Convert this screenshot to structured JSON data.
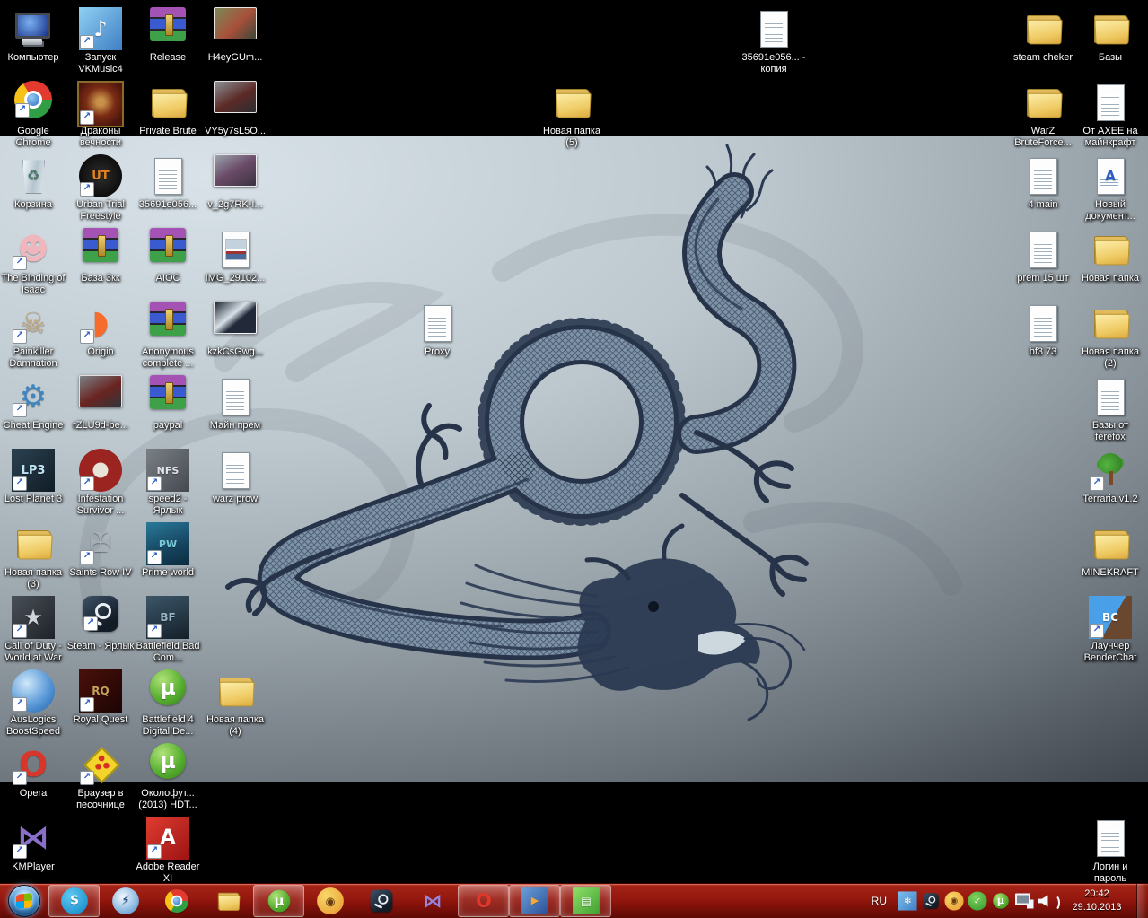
{
  "colors": {
    "taskbar_red": "#94180e",
    "wallpaper_light": "#d8e2e8",
    "wallpaper_dark": "#333940",
    "dragon_ink": "#2b3a52"
  },
  "icons_meta": {
    "shortcut_arrow_glyph": "↗"
  },
  "desktop": {
    "icons": [
      {
        "id": "computer",
        "label": "Компьютер",
        "col": 0,
        "row": 0,
        "art": {
          "kind": "computer"
        }
      },
      {
        "id": "vkmusic4",
        "label": "Запуск VKMusic4",
        "col": 1,
        "row": 0,
        "art": {
          "kind": "app",
          "bg": "linear-gradient(135deg,#8fd0f4,#3f7fc4)",
          "glyph": "♪",
          "fg": "#ffffff",
          "fs": 24,
          "shortcut": true
        }
      },
      {
        "id": "release",
        "label": "Release",
        "col": 2,
        "row": 0,
        "art": {
          "kind": "rar"
        }
      },
      {
        "id": "h4eygum",
        "label": "H4eyGUm...",
        "col": 3,
        "row": 0,
        "art": {
          "kind": "photo",
          "bg": "linear-gradient(135deg,#7a8a5a,#a8503a 55%,#3c4638)"
        }
      },
      {
        "id": "google-chrome",
        "label": "Google Chrome",
        "col": 0,
        "row": 1,
        "art": {
          "kind": "chrome",
          "shortcut": true
        }
      },
      {
        "id": "drakony-vechnosti",
        "label": "Драконы вечности",
        "col": 1,
        "row": 1,
        "art": {
          "kind": "app",
          "bg": "radial-gradient(circle at 50% 45%,#c89048 12%,#7a2c14 45%,#4a150d 80%)",
          "border": "#8a6a2a",
          "shortcut": true
        }
      },
      {
        "id": "private-brute",
        "label": "Private Brute",
        "col": 2,
        "row": 1,
        "art": {
          "kind": "folder"
        }
      },
      {
        "id": "vy5y7sl5o",
        "label": "VY5y7sL5O...",
        "col": 3,
        "row": 1,
        "art": {
          "kind": "photo",
          "bg": "linear-gradient(150deg,#8a9298,#5c2a26 55%,#2a2e33)"
        }
      },
      {
        "id": "recycle-bin",
        "label": "Корзина",
        "col": 0,
        "row": 2,
        "art": {
          "kind": "recycle",
          "glyph": "♻",
          "fg": "#4a7a6a",
          "fs": 16
        }
      },
      {
        "id": "urban-trial",
        "label": "Urban Trial Freestyle",
        "col": 1,
        "row": 2,
        "art": {
          "kind": "app",
          "bg": "radial-gradient(circle,#2e2e2e,#000000)",
          "glyph": "UT",
          "fg": "#e8821e",
          "fs": 13,
          "round": true,
          "bold": true,
          "shortcut": true
        }
      },
      {
        "id": "doc-35691e056",
        "label": "35691e056...",
        "col": 2,
        "row": 2,
        "art": {
          "kind": "doc"
        }
      },
      {
        "id": "v2g7rk",
        "label": "v_2g7RK-I...",
        "col": 3,
        "row": 2,
        "art": {
          "kind": "photo",
          "bg": "linear-gradient(150deg,#9aa4ac,#6a4a68 50%,#3a3340)"
        }
      },
      {
        "id": "binding-of-isaac",
        "label": "The Binding of Isaac",
        "col": 0,
        "row": 3,
        "art": {
          "kind": "app",
          "glyph": "☻",
          "fg": "#f0b6be",
          "fs": 34,
          "shortcut": true
        }
      },
      {
        "id": "baza-3kk",
        "label": "База 3кк",
        "col": 1,
        "row": 3,
        "art": {
          "kind": "rar"
        }
      },
      {
        "id": "aioc",
        "label": "AIOC",
        "col": 2,
        "row": 3,
        "art": {
          "kind": "rar"
        }
      },
      {
        "id": "img-29102",
        "label": "IMG_29102...",
        "col": 3,
        "row": 3,
        "art": {
          "kind": "imgdoc"
        }
      },
      {
        "id": "painkiller-damnation",
        "label": "Painkiller Damnation",
        "col": 0,
        "row": 4,
        "art": {
          "kind": "app",
          "glyph": "☠",
          "fg": "#c8a87a",
          "fs": 32,
          "shortcut": true
        }
      },
      {
        "id": "origin",
        "label": "Origin",
        "col": 1,
        "row": 4,
        "art": {
          "kind": "app",
          "glyph": "◗",
          "fg": "#f56c2d",
          "fs": 36,
          "bold": true,
          "shortcut": true
        }
      },
      {
        "id": "anonymous-complete",
        "label": "Anonymous complete ...",
        "col": 2,
        "row": 4,
        "art": {
          "kind": "rar"
        }
      },
      {
        "id": "kzkcsgwg",
        "label": "kzkCsGwg...",
        "col": 3,
        "row": 4,
        "art": {
          "kind": "photo",
          "bg": "linear-gradient(140deg,#1c2430,#d8e0e8 42%,#222a3a 60%)"
        }
      },
      {
        "id": "cheat-engine",
        "label": "Cheat Engine",
        "col": 0,
        "row": 5,
        "art": {
          "kind": "app",
          "glyph": "⚙",
          "fg": "#3f86c0",
          "fs": 34,
          "shortcut": true
        }
      },
      {
        "id": "rzlu9d",
        "label": "rZLU9d-be...",
        "col": 1,
        "row": 5,
        "art": {
          "kind": "photo",
          "bg": "linear-gradient(150deg,#7a8288,#6a2420 55%,#30353a)"
        }
      },
      {
        "id": "paypal",
        "label": "paypal",
        "col": 2,
        "row": 5,
        "art": {
          "kind": "rar"
        }
      },
      {
        "id": "main-prem",
        "label": "Майн прем",
        "col": 3,
        "row": 5,
        "art": {
          "kind": "doc"
        }
      },
      {
        "id": "lost-planet-3",
        "label": "Lost Planet 3",
        "col": 0,
        "row": 6,
        "art": {
          "kind": "app",
          "bg": "linear-gradient(135deg,#2c4250,#101c26)",
          "glyph": "LP3",
          "fg": "#bfe3f4",
          "fs": 13,
          "bold": true,
          "shortcut": true
        }
      },
      {
        "id": "infestation",
        "label": "Infestation Survivor ...",
        "col": 1,
        "row": 6,
        "art": {
          "kind": "app",
          "bg": "radial-gradient(circle,#e8e4da 24%,#9c2420 26%)",
          "round": true,
          "shortcut": true
        }
      },
      {
        "id": "speed2",
        "label": "speed2 - Ярлык",
        "col": 2,
        "row": 6,
        "art": {
          "kind": "app",
          "bg": "linear-gradient(135deg,#7a8086,#44494f)",
          "glyph": "NFS",
          "fg": "#e0e4e8",
          "fs": 11,
          "bold": true,
          "shortcut": true
        }
      },
      {
        "id": "warz-prow",
        "label": "warz prow",
        "col": 3,
        "row": 6,
        "art": {
          "kind": "doc"
        }
      },
      {
        "id": "new-folder-3",
        "label": "Новая папка (3)",
        "col": 0,
        "row": 7,
        "art": {
          "kind": "folder"
        }
      },
      {
        "id": "saints-row-iv",
        "label": "Saints Row IV",
        "col": 1,
        "row": 7,
        "art": {
          "kind": "app",
          "glyph": "✠",
          "fg": "#a8aeb6",
          "fs": 30,
          "shortcut": true
        }
      },
      {
        "id": "prime-world",
        "label": "Prime world",
        "col": 2,
        "row": 7,
        "art": {
          "kind": "app",
          "bg": "linear-gradient(160deg,#2a7a9a,#15445e 60%,#0c2c40)",
          "glyph": "PW",
          "fg": "#7ac8d8",
          "fs": 11,
          "bold": true,
          "shortcut": true
        }
      },
      {
        "id": "call-of-duty-waw",
        "label": "Call of Duty - World at War",
        "col": 0,
        "row": 8,
        "art": {
          "kind": "app",
          "bg": "linear-gradient(135deg,#4a5058,#1e2228)",
          "glyph": "★",
          "fg": "#d0d4d8",
          "fs": 24,
          "shortcut": true
        }
      },
      {
        "id": "steam-shortcut",
        "label": "Steam - Ярлык",
        "col": 1,
        "row": 8,
        "art": {
          "kind": "steam",
          "shortcut": true
        }
      },
      {
        "id": "battlefield-bc",
        "label": "Battlefield Bad Com...",
        "col": 2,
        "row": 8,
        "art": {
          "kind": "app",
          "bg": "linear-gradient(160deg,#3c5668,#141f28)",
          "glyph": "BF",
          "fg": "#9ab4c4",
          "fs": 12,
          "bold": true,
          "shortcut": true
        }
      },
      {
        "id": "auslogics-boostspeed",
        "label": "AusLogics BoostSpeed",
        "col": 0,
        "row": 9,
        "art": {
          "kind": "app",
          "bg": "radial-gradient(circle at 35% 32%,#cfe8fa,#5a9ad8 55%,#1f5fa8)",
          "round": true,
          "shortcut": true
        }
      },
      {
        "id": "royal-quest",
        "label": "Royal Quest",
        "col": 1,
        "row": 9,
        "art": {
          "kind": "app",
          "bg": "linear-gradient(135deg,#4a100a,#1c0504)",
          "glyph": "RQ",
          "fg": "#c8a05a",
          "fs": 12,
          "bold": true,
          "shortcut": true
        }
      },
      {
        "id": "battlefield-4-torrent",
        "label": "Battlefield 4 Digital De...",
        "col": 2,
        "row": 9,
        "art": {
          "kind": "utorrent",
          "glyph": "µ",
          "fg": "#ffffff",
          "fs": 24,
          "bold": true
        }
      },
      {
        "id": "new-folder-4",
        "label": "Новая папка (4)",
        "col": 3,
        "row": 9,
        "art": {
          "kind": "folder"
        }
      },
      {
        "id": "opera",
        "label": "Opera",
        "col": 0,
        "row": 10,
        "art": {
          "kind": "app",
          "glyph": "O",
          "fg": "#d8362a",
          "fs": 38,
          "bold": true,
          "shortcut": true
        }
      },
      {
        "id": "sandbox-browser",
        "label": "Браузер в песочнице",
        "col": 1,
        "row": 10,
        "art": {
          "kind": "sandbox",
          "shortcut": true
        }
      },
      {
        "id": "okolofutbola-torrent",
        "label": "Околофут... (2013) HDT...",
        "col": 2,
        "row": 10,
        "art": {
          "kind": "utorrent",
          "glyph": "µ",
          "fg": "#ffffff",
          "fs": 24,
          "bold": true
        }
      },
      {
        "id": "kmplayer",
        "label": "KMPlayer",
        "col": 0,
        "row": 11,
        "art": {
          "kind": "app",
          "glyph": "⋈",
          "fg": "#8a6fc8",
          "fs": 36,
          "bold": true,
          "shortcut": true
        }
      },
      {
        "id": "adobe-reader-xi",
        "label": "Adobe Reader XI",
        "col": 2,
        "row": 11,
        "art": {
          "kind": "app",
          "bg": "linear-gradient(135deg,#e03c30,#9c1414)",
          "glyph": "A",
          "fg": "#ffffff",
          "fs": 22,
          "bold": true,
          "shortcut": true
        }
      },
      {
        "id": "proxy",
        "label": "Proxy",
        "col": 6,
        "row": 4,
        "art": {
          "kind": "doc"
        }
      },
      {
        "id": "new-folder-5",
        "label": "Новая папка (5)",
        "col": 8,
        "row": 1,
        "art": {
          "kind": "folder"
        }
      },
      {
        "id": "doc-35691e056-copy",
        "label": "35691e056... - копия",
        "col": 11,
        "row": 0,
        "art": {
          "kind": "doc"
        }
      },
      {
        "id": "steam-cheker",
        "label": "steam cheker",
        "col": 15,
        "row": 0,
        "art": {
          "kind": "folder"
        }
      },
      {
        "id": "bazy",
        "label": "Базы",
        "col": 16,
        "row": 0,
        "art": {
          "kind": "folder"
        }
      },
      {
        "id": "warz-bruteforce",
        "label": "WarZ BruteForce...",
        "col": 15,
        "row": 1,
        "art": {
          "kind": "folder"
        }
      },
      {
        "id": "ot-axee",
        "label": "От AXEE на майнкрафт",
        "col": 16,
        "row": 1,
        "art": {
          "kind": "doc"
        }
      },
      {
        "id": "4-main",
        "label": "4 main",
        "col": 15,
        "row": 2,
        "art": {
          "kind": "doc"
        }
      },
      {
        "id": "new-document",
        "label": "Новый документ...",
        "col": 16,
        "row": 2,
        "art": {
          "kind": "worddoc",
          "glyph": "A",
          "fg": "#2a5fc4",
          "fs": 15,
          "bold": true
        }
      },
      {
        "id": "prem-15",
        "label": "prem 15 шт",
        "col": 15,
        "row": 3,
        "art": {
          "kind": "doc"
        }
      },
      {
        "id": "new-folder",
        "label": "Новая папка",
        "col": 16,
        "row": 3,
        "art": {
          "kind": "folder"
        }
      },
      {
        "id": "bf3-73",
        "label": "bf3 73",
        "col": 15,
        "row": 4,
        "art": {
          "kind": "doc"
        }
      },
      {
        "id": "new-folder-2",
        "label": "Новая папка (2)",
        "col": 16,
        "row": 4,
        "art": {
          "kind": "folder"
        }
      },
      {
        "id": "bazy-ot-ferefox",
        "label": "Базы от ferefox",
        "col": 16,
        "row": 5,
        "art": {
          "kind": "doc"
        }
      },
      {
        "id": "terraria",
        "label": "Terraria v1.2",
        "col": 16,
        "row": 6,
        "art": {
          "kind": "tree",
          "shortcut": true
        }
      },
      {
        "id": "minekraft",
        "label": "MINEKRAFT",
        "col": 16,
        "row": 7,
        "art": {
          "kind": "folder"
        }
      },
      {
        "id": "launcher-benderchat",
        "label": "Лаунчер BenderChat",
        "col": 16,
        "row": 8,
        "art": {
          "kind": "app",
          "bg": "linear-gradient(120deg,#4aa0e8 0 55%,#6a4830 55% 100%)",
          "glyph": "BC",
          "fg": "#ffffff",
          "fs": 12,
          "bold": true,
          "shortcut": true
        }
      },
      {
        "id": "login-i-parol",
        "label": "Логин и пароль",
        "col": 16,
        "row": 11,
        "art": {
          "kind": "doc"
        }
      }
    ]
  },
  "taskbar": {
    "buttons": [
      {
        "id": "skype",
        "active": true,
        "art": {
          "kind": "app",
          "bg": "radial-gradient(circle at 35% 30%,#5ec8f0,#0f86c8)",
          "glyph": "S",
          "fg": "#ffffff",
          "fs": 22,
          "round": true,
          "bold": true
        }
      },
      {
        "id": "daemon-tools",
        "active": false,
        "art": {
          "kind": "app",
          "bg": "radial-gradient(circle at 40% 35%,#f4faff,#8ab8e0 60%,#4a84c0)",
          "glyph": "⚡",
          "fg": "#1c4f8a",
          "fs": 22,
          "round": true
        }
      },
      {
        "id": "chrome",
        "active": false,
        "art": {
          "kind": "chrome"
        }
      },
      {
        "id": "windows-explorer",
        "active": false,
        "art": {
          "kind": "folder"
        }
      },
      {
        "id": "utorrent",
        "active": true,
        "art": {
          "kind": "utorrent",
          "glyph": "µ",
          "fg": "#ffffff",
          "fs": 24,
          "bold": true
        }
      },
      {
        "id": "mediaget",
        "active": false,
        "art": {
          "kind": "app",
          "bg": "radial-gradient(circle at 35% 30%,#f8d868,#e8962e)",
          "glyph": "◉",
          "fg": "#6a3c10",
          "fs": 20,
          "round": true
        }
      },
      {
        "id": "steam",
        "active": false,
        "art": {
          "kind": "steam"
        }
      },
      {
        "id": "kmplayer",
        "active": false,
        "art": {
          "kind": "app",
          "glyph": "⋈",
          "fg": "#9a82d8",
          "fs": 34,
          "bold": true
        }
      },
      {
        "id": "opera",
        "active": true,
        "art": {
          "kind": "app",
          "glyph": "O",
          "fg": "#e0382a",
          "fs": 34,
          "bold": true
        }
      },
      {
        "id": "windows-media-player",
        "active": true,
        "art": {
          "kind": "app",
          "bg": "linear-gradient(135deg,#6a9fd8,#2a4f98)",
          "glyph": "▶",
          "fg": "#f8a838",
          "fs": 18
        }
      },
      {
        "id": "notepad",
        "active": true,
        "art": {
          "kind": "app",
          "bg": "linear-gradient(135deg,#8fe06a,#3fa02f)",
          "glyph": "▤",
          "fg": "#f0fff0",
          "fs": 20
        }
      }
    ]
  },
  "tray": {
    "language": "RU",
    "time": "20:42",
    "date": "29.10.2013",
    "icons": [
      {
        "id": "vkmusic",
        "art": {
          "kind": "app",
          "bg": "linear-gradient(135deg,#7ec0ee,#3f7fc4)",
          "glyph": "❄",
          "fg": "#ffffff",
          "fs": 24
        }
      },
      {
        "id": "steam",
        "art": {
          "kind": "steam"
        }
      },
      {
        "id": "mediaget",
        "art": {
          "kind": "app",
          "bg": "radial-gradient(circle at 35% 30%,#f8d868,#e8962e)",
          "glyph": "◉",
          "fg": "#6a3c10",
          "fs": 22,
          "round": true
        }
      },
      {
        "id": "agent-online",
        "art": {
          "kind": "app",
          "bg": "radial-gradient(circle at 40% 32%,#7ed45e,#2f9428)",
          "glyph": "✓",
          "fg": "#ffffff",
          "fs": 24,
          "round": true,
          "bold": true
        }
      },
      {
        "id": "utorrent",
        "art": {
          "kind": "utorrent",
          "glyph": "µ",
          "fg": "#ffffff",
          "fs": 26,
          "bold": true
        }
      },
      {
        "id": "network",
        "art": {
          "kind": "network"
        }
      },
      {
        "id": "volume",
        "art": {
          "kind": "volume"
        }
      }
    ]
  }
}
